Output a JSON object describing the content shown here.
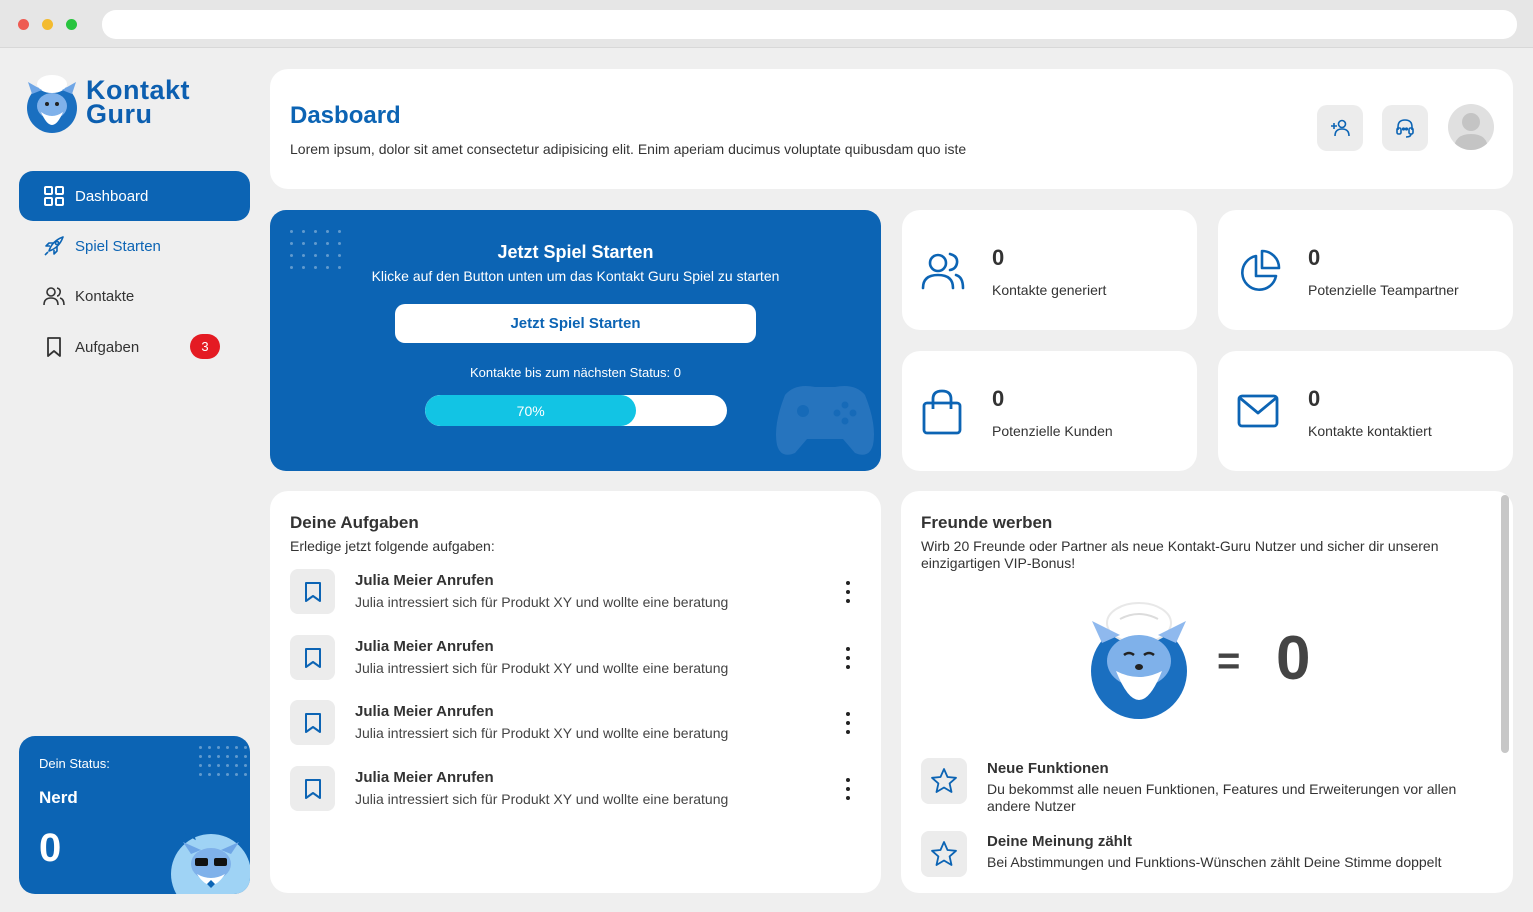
{
  "app": {
    "logo_line1": "Kontakt",
    "logo_line2": "Guru"
  },
  "sidebar": {
    "items": [
      {
        "label": "Dashboard",
        "icon": "grid-icon",
        "active": true
      },
      {
        "label": "Spiel Starten",
        "icon": "rocket-icon"
      },
      {
        "label": "Kontakte",
        "icon": "users-icon"
      },
      {
        "label": "Aufgaben",
        "icon": "bookmark-icon",
        "badge": "3"
      }
    ],
    "status": {
      "label": "Dein Status:",
      "name": "Nerd",
      "value": "0"
    }
  },
  "header": {
    "title": "Dasboard",
    "subtitle": "Lorem ipsum, dolor sit amet consectetur adipisicing elit. Enim aperiam ducimus voluptate quibusdam quo iste",
    "buttons": [
      "add-user-icon",
      "headset-icon"
    ],
    "avatar": "avatar"
  },
  "game": {
    "title": "Jetzt Spiel Starten",
    "subtitle": "Klicke auf den Button unten um das Kontakt Guru Spiel zu starten",
    "button_label": "Jetzt Spiel Starten",
    "progress_label": "Kontakte bis zum nächsten Status: 0",
    "progress_text": "70%",
    "progress_value": 0.7
  },
  "stats": [
    {
      "value": "0",
      "label": "Kontakte generiert",
      "icon": "users-icon"
    },
    {
      "value": "0",
      "label": "Potenzielle Teampartner",
      "icon": "pie-chart-icon"
    },
    {
      "value": "0",
      "label": "Potenzielle Kunden",
      "icon": "shopping-bag-icon"
    },
    {
      "value": "0",
      "label": "Kontakte kontaktiert",
      "icon": "mail-icon"
    }
  ],
  "tasks": {
    "title": "Deine Aufgaben",
    "subtitle": "Erledige jetzt folgende aufgaben:",
    "items": [
      {
        "title": "Julia Meier Anrufen",
        "desc": "Julia intressiert sich für Produkt XY und wollte eine beratung"
      },
      {
        "title": "Julia Meier Anrufen",
        "desc": "Julia intressiert sich für Produkt XY und wollte eine beratung"
      },
      {
        "title": "Julia Meier Anrufen",
        "desc": "Julia intressiert sich für Produkt XY und wollte eine beratung"
      },
      {
        "title": "Julia Meier Anrufen",
        "desc": "Julia intressiert sich für Produkt XY und wollte eine beratung"
      }
    ]
  },
  "friends": {
    "title": "Freunde werben",
    "subtitle": "Wirb 20 Freunde oder Partner als neue Kontakt-Guru Nutzer und sicher dir unseren einzigartigen VIP-Bonus!",
    "equals": "=",
    "count": "0",
    "features": [
      {
        "title": "Neue Funktionen",
        "desc": "Du bekommst alle neuen Funktionen, Features und Erweiterungen vor allen andere Nutzer",
        "icon": "star-icon"
      },
      {
        "title": "Deine Meinung zählt",
        "desc": "Bei Abstimmungen und Funktions-Wünschen zählt Deine Stimme doppelt",
        "icon": "star-icon"
      }
    ]
  },
  "colors": {
    "brand": "#0c64b4",
    "progress": "#12c4e4",
    "badge": "#e41b23"
  }
}
